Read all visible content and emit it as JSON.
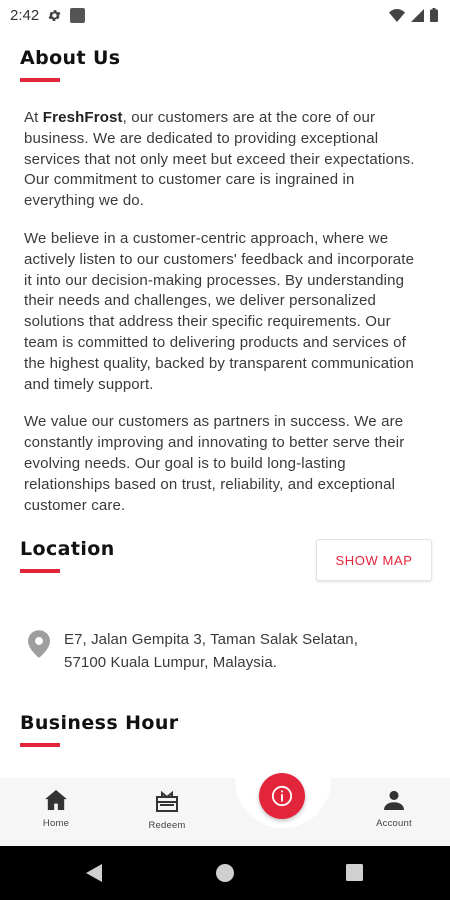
{
  "status_bar": {
    "time": "2:42"
  },
  "about": {
    "title": "About Us",
    "p1_prefix": "At ",
    "brand": "FreshFrost",
    "p1_rest": ", our customers are at the core of our business. We are dedicated to providing exceptional services that not only meet but exceed their expectations. Our commitment to customer care is ingrained in everything we do.",
    "p2": "We believe in a customer-centric approach, where we actively listen to our customers' feedback and incorporate it into our decision-making processes. By understanding their needs and challenges, we deliver personalized solutions that address their specific requirements. Our team is committed to delivering products and services of the highest quality, backed by transparent communication and timely support.",
    "p3": "We value our customers as partners in success. We are constantly improving and innovating to better serve their evolving needs. Our goal is to build long-lasting relationships based on trust, reliability, and exceptional customer care."
  },
  "location": {
    "title": "Location",
    "show_map_label": "SHOW MAP",
    "address_line1": "E7, Jalan Gempita 3, Taman Salak Selatan,",
    "address_line2": "57100 Kuala Lumpur, Malaysia."
  },
  "business_hour": {
    "title": "Business Hour"
  },
  "bottom_nav": {
    "home_label": "Home",
    "redeem_label": "Redeem",
    "account_label": "Account"
  },
  "colors": {
    "accent": "#e3253b",
    "nav_background": "#f6f6f6",
    "system_nav": "#000000"
  },
  "icons": {
    "status": [
      "gear-icon",
      "square-notification-icon",
      "wifi-icon",
      "signal-icon",
      "battery-icon"
    ],
    "location": "location-pin-icon",
    "nav": [
      "home-icon",
      "gift-icon",
      "info-icon",
      "person-icon"
    ],
    "system": [
      "back-icon",
      "home-circle-icon",
      "recents-icon"
    ]
  }
}
